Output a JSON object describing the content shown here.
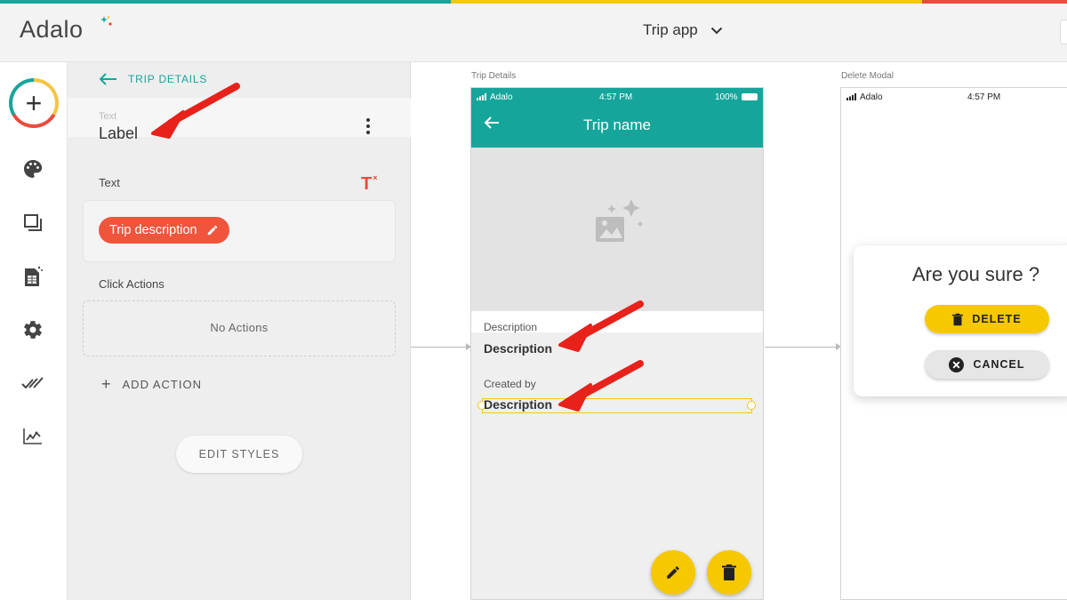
{
  "colors": {
    "strip": [
      "#16a59b",
      "#f5c518",
      "#e94b3c"
    ],
    "teal": "#16a59b",
    "chip_red": "#f0553c",
    "yellow": "#f6c800",
    "annotation_arrow": "#e8211b"
  },
  "header": {
    "logo": "Adalo",
    "app_name": "Trip app",
    "app_dropdown_icon": "chevron-down-icon"
  },
  "rail": {
    "icons": [
      "add-icon",
      "palette-icon",
      "screens-icon",
      "database-icon",
      "settings-icon",
      "publish-icon",
      "analytics-icon"
    ]
  },
  "panel": {
    "back_label": "TRIP DETAILS",
    "component_type": "Text",
    "component_name": "Label",
    "text_section_label": "Text",
    "text_chip": "Trip description",
    "click_actions_label": "Click Actions",
    "no_actions": "No Actions",
    "add_action": "ADD ACTION",
    "edit_styles": "EDIT STYLES"
  },
  "canvas": {
    "screen1": {
      "title": "Trip Details",
      "status_carrier": "Adalo",
      "status_time": "4:57 PM",
      "status_battery": "100%",
      "appbar_title": "Trip name",
      "description_label": "Description",
      "description_value": "Description",
      "created_by_label": "Created by",
      "created_by_value": "Description",
      "fab_icons": [
        "edit-icon",
        "trash-icon"
      ]
    },
    "screen2": {
      "title": "Delete Modal",
      "status_carrier": "Adalo",
      "status_time": "4:57 PM",
      "modal_title": "Are you sure ?",
      "delete_label": "DELETE",
      "cancel_label": "CANCEL"
    }
  }
}
